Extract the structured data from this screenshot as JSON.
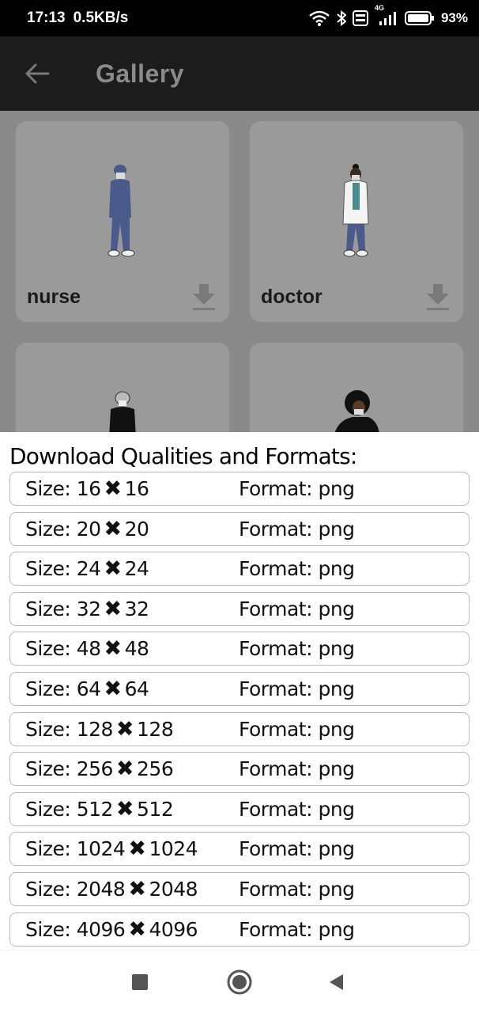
{
  "status_bar": {
    "time": "17:13",
    "speed": "0.5KB/s",
    "network": "4G",
    "battery": "93%"
  },
  "app_bar": {
    "title": "Gallery",
    "back_icon": "arrow-left-icon"
  },
  "gallery": {
    "cards": [
      {
        "label": "nurse"
      },
      {
        "label": "doctor"
      },
      {
        "label": ""
      },
      {
        "label": ""
      }
    ]
  },
  "sheet": {
    "title": "Download Qualities and Formats:",
    "options": [
      {
        "size_label": "Size: 16",
        "size_b": "16",
        "format": "Format: png"
      },
      {
        "size_label": "Size: 20",
        "size_b": "20",
        "format": "Format: png"
      },
      {
        "size_label": "Size: 24",
        "size_b": "24",
        "format": "Format: png"
      },
      {
        "size_label": "Size: 32",
        "size_b": "32",
        "format": "Format: png"
      },
      {
        "size_label": "Size: 48",
        "size_b": "48",
        "format": "Format: png"
      },
      {
        "size_label": "Size: 64",
        "size_b": "64",
        "format": "Format: png"
      },
      {
        "size_label": "Size: 128",
        "size_b": "128",
        "format": "Format: png"
      },
      {
        "size_label": "Size: 256",
        "size_b": "256",
        "format": "Format: png"
      },
      {
        "size_label": "Size: 512",
        "size_b": "512",
        "format": "Format: png"
      },
      {
        "size_label": "Size: 1024",
        "size_b": "1024",
        "format": "Format: png"
      },
      {
        "size_label": "Size: 2048",
        "size_b": "2048",
        "format": "Format: png"
      },
      {
        "size_label": "Size: 4096",
        "size_b": "4096",
        "format": "Format: png"
      }
    ]
  },
  "colors": {
    "status_bar_bg": "#000000",
    "app_bar_bg": "#1c1c1c",
    "scrim": "#8a8a8a",
    "row_border": "#b9b9b9"
  }
}
